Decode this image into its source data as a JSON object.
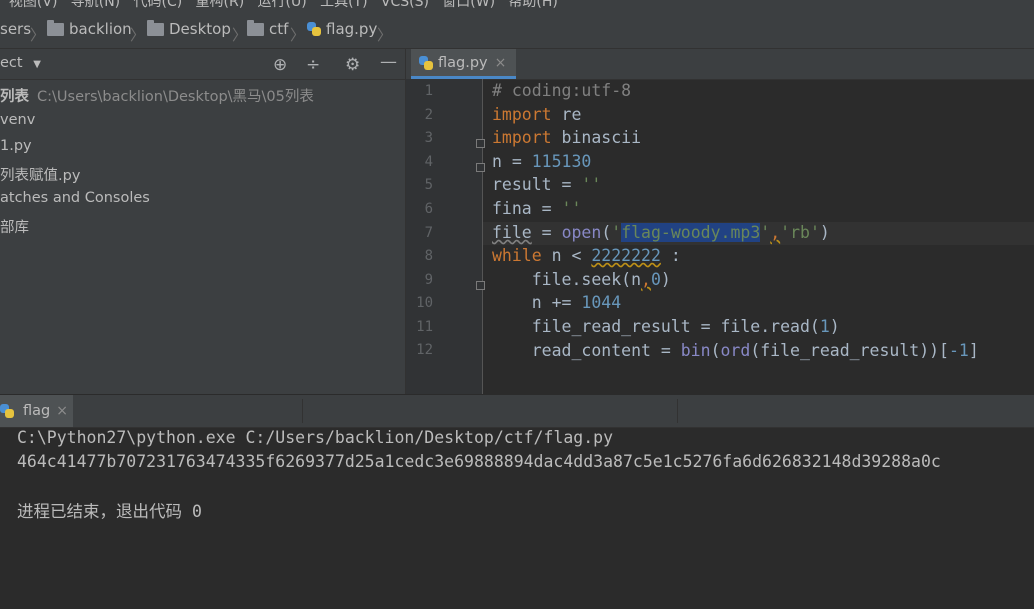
{
  "menubar": {
    "text": "  视图(V)   导航(N)   代码(C)   重构(R)   运行(U)   工具(T)   VCS(S)   窗口(W)   帮助(H)"
  },
  "breadcrumbs": [
    {
      "label": "sers"
    },
    {
      "label": "backlion"
    },
    {
      "label": "Desktop"
    },
    {
      "label": "ctf"
    },
    {
      "label": "flag.py"
    }
  ],
  "project": {
    "title": "ect",
    "items": [
      {
        "label": "列表",
        "path": "C:\\Users\\backlion\\Desktop\\黑马\\05列表"
      },
      {
        "label": "venv"
      },
      {
        "label": "1.py"
      },
      {
        "label": "列表赋值.py"
      },
      {
        "label": "atches and Consoles"
      },
      {
        "label": "部库"
      }
    ]
  },
  "editor": {
    "tab_label": "flag.py",
    "tab_close": "×",
    "line_numbers": [
      "1",
      "2",
      "3",
      "4",
      "5",
      "6",
      "7",
      "8",
      "9",
      "10",
      "11",
      "12"
    ],
    "lines": {
      "l1": "# coding:utf-8",
      "l2_kw": "import",
      "l2_mod": " re",
      "l3_kw": "import",
      "l3_mod": " binascii",
      "l4_a": "n = ",
      "l4_num": "115130",
      "l5_a": "result = ",
      "l5_str": "''",
      "l6_a": "fina = ",
      "l6_str": "''",
      "l7_a": "file",
      "l7_b": " = ",
      "l7_fn": "open",
      "l7_c": "(",
      "l7_q1": "'",
      "l7_sel": "flag-woody.mp3",
      "l7_q2": "'",
      "l7_comma": ",",
      "l7_str2": "'rb'",
      "l7_end": ")",
      "l8_kw": "while",
      "l8_a": " n < ",
      "l8_num": "2222222",
      "l8_b": " :",
      "l9_a": "    file.seek(n",
      "l9_comma": ",",
      "l9_num": "0",
      "l9_b": ")",
      "l10_a": "    n += ",
      "l10_num": "1044",
      "l11_a": "    file_read_result = file.read(",
      "l11_num": "1",
      "l11_b": ")",
      "l12_a": "    read_content = ",
      "l12_bin": "bin",
      "l12_b": "(",
      "l12_ord": "ord",
      "l12_c": "(file_read_result))[",
      "l12_num": "-1",
      "l12_d": "]"
    }
  },
  "run": {
    "tab_label": "flag",
    "tab_close": "×",
    "command": "C:\\Python27\\python.exe C:/Users/backlion/Desktop/ctf/flag.py",
    "output": "464c41477b707231763474335f6269377d25a1cedc3e69888894dac4dd3a87c5e1c5276fa6d626832148d39288a0c",
    "exit_text": "进程已结束，退出代码 ",
    "exit_code": "0"
  },
  "colors": {
    "keyword": "#cc7832",
    "number": "#6897bb",
    "string": "#6a8759",
    "comment": "#808080",
    "selection": "#214283"
  }
}
